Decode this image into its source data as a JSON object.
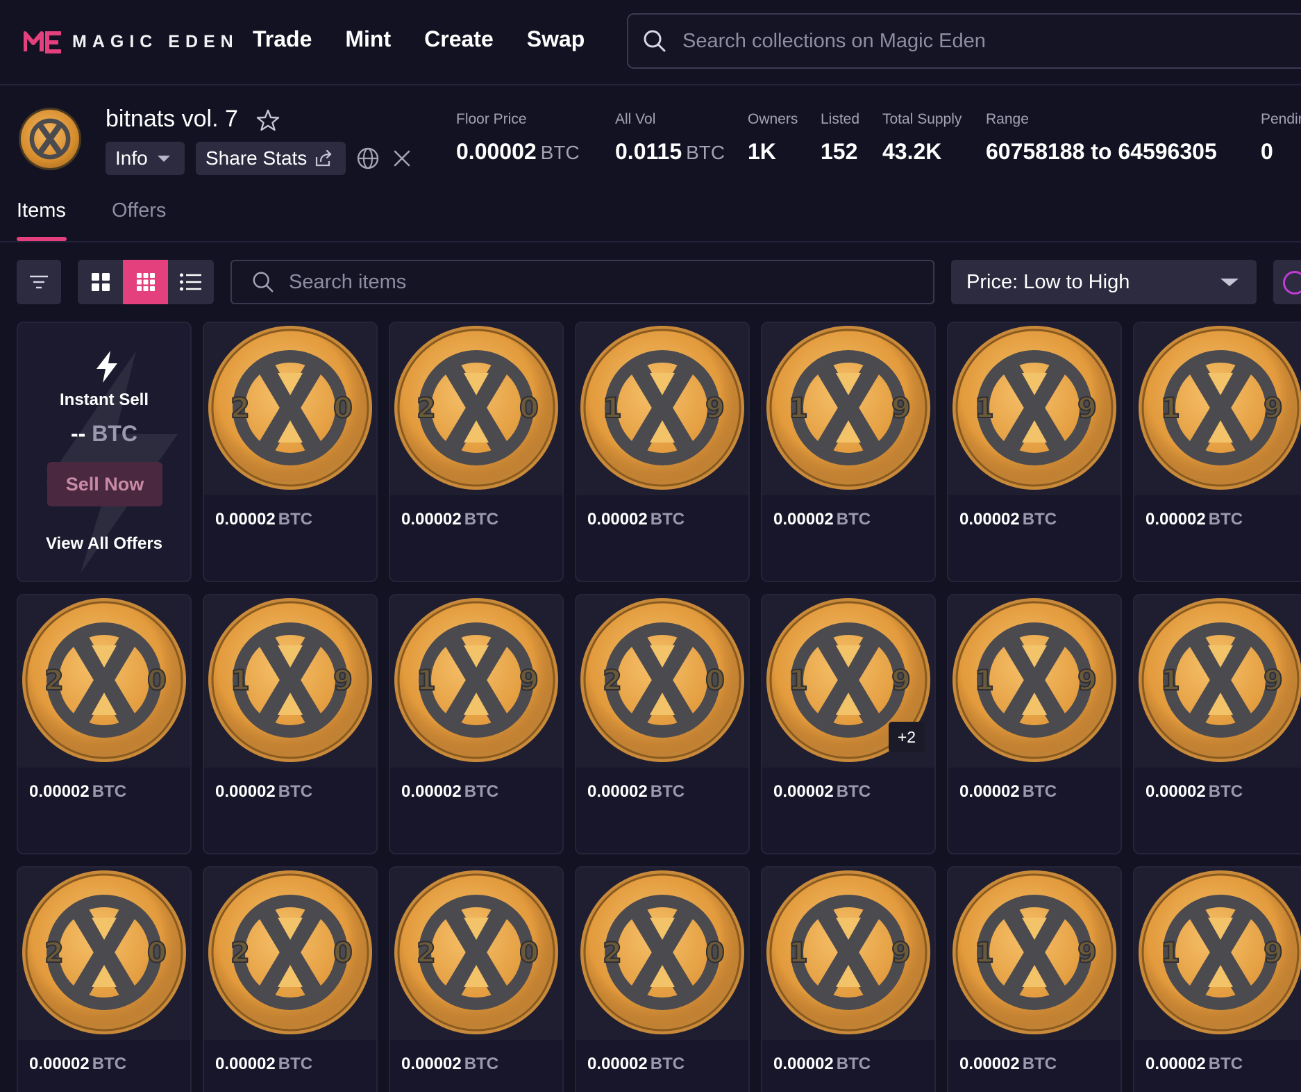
{
  "nav": {
    "brand": "MAGIC EDEN",
    "links": [
      "Trade",
      "Mint",
      "Create",
      "Swap"
    ],
    "search_placeholder": "Search collections on Magic Eden"
  },
  "collection": {
    "name": "bitnats vol. 7",
    "info_label": "Info",
    "share_label": "Share Stats",
    "stats": [
      {
        "label": "Floor Price",
        "value": "0.00002",
        "unit": "BTC"
      },
      {
        "label": "All Vol",
        "value": "0.0115",
        "unit": "BTC"
      },
      {
        "label": "Owners",
        "value": "1K",
        "unit": ""
      },
      {
        "label": "Listed",
        "value": "152",
        "unit": ""
      },
      {
        "label": "Total Supply",
        "value": "43.2K",
        "unit": ""
      },
      {
        "label": "Range",
        "value": "60758188 to 64596305",
        "unit": ""
      },
      {
        "label": "Pendin",
        "value": "0",
        "unit": ""
      }
    ]
  },
  "tabs": [
    "Items",
    "Offers"
  ],
  "toolbar": {
    "search_placeholder": "Search items",
    "sort_selected": "Price: Low to High"
  },
  "instant_sell": {
    "title": "Instant Sell",
    "amount": "--",
    "unit": "BTC",
    "sell_button": "Sell Now",
    "view_offers": "View All Offers"
  },
  "items": [
    {
      "price": "0.00002",
      "unit": "BTC",
      "left": "2",
      "right": "0"
    },
    {
      "price": "0.00002",
      "unit": "BTC",
      "left": "2",
      "right": "0"
    },
    {
      "price": "0.00002",
      "unit": "BTC",
      "left": "1",
      "right": "9"
    },
    {
      "price": "0.00002",
      "unit": "BTC",
      "left": "1",
      "right": "9"
    },
    {
      "price": "0.00002",
      "unit": "BTC",
      "left": "1",
      "right": "9"
    },
    {
      "price": "0.00002",
      "unit": "BTC",
      "left": "1",
      "right": "9"
    },
    {
      "price": "0.00002",
      "unit": "BTC",
      "left": "2",
      "right": "0"
    },
    {
      "price": "0.00002",
      "unit": "BTC",
      "left": "1",
      "right": "9"
    },
    {
      "price": "0.00002",
      "unit": "BTC",
      "left": "1",
      "right": "9"
    },
    {
      "price": "0.00002",
      "unit": "BTC",
      "left": "2",
      "right": "0"
    },
    {
      "price": "0.00002",
      "unit": "BTC",
      "left": "1",
      "right": "9",
      "badge": "+2"
    },
    {
      "price": "0.00002",
      "unit": "BTC",
      "left": "1",
      "right": "9"
    },
    {
      "price": "0.00002",
      "unit": "BTC",
      "left": "1",
      "right": "9"
    },
    {
      "price": "0.00002",
      "unit": "BTC",
      "left": "2",
      "right": "0"
    },
    {
      "price": "0.00002",
      "unit": "BTC",
      "left": "2",
      "right": "0"
    },
    {
      "price": "0.00002",
      "unit": "BTC",
      "left": "2",
      "right": "0"
    },
    {
      "price": "0.00002",
      "unit": "BTC",
      "left": "2",
      "right": "0"
    },
    {
      "price": "0.00002",
      "unit": "BTC",
      "left": "1",
      "right": "9"
    },
    {
      "price": "0.00002",
      "unit": "BTC",
      "left": "1",
      "right": "9"
    },
    {
      "price": "0.00002",
      "unit": "BTC",
      "left": "1",
      "right": "9"
    }
  ],
  "colors": {
    "background": "#131222",
    "accent": "#e4407e",
    "coin_gold": "#e8a445",
    "coin_dark": "#4b4a4f"
  },
  "icons": [
    "search-icon",
    "star-icon",
    "chevron-down-icon",
    "share-icon",
    "globe-icon",
    "x-logo-icon",
    "filter-icon",
    "grid-large-icon",
    "grid-small-icon",
    "list-icon",
    "lightning-icon",
    "coin-image"
  ]
}
